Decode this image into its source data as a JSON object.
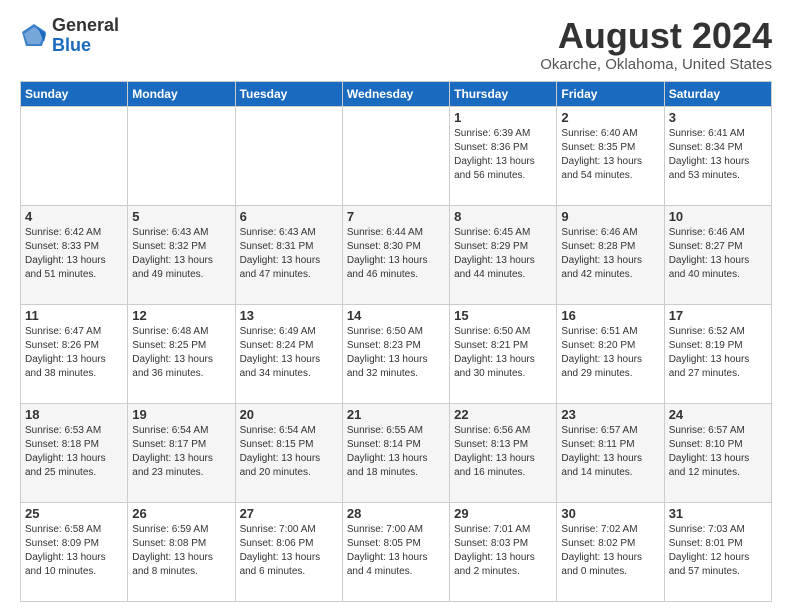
{
  "logo": {
    "general": "General",
    "blue": "Blue"
  },
  "header": {
    "title": "August 2024",
    "subtitle": "Okarche, Oklahoma, United States"
  },
  "weekdays": [
    "Sunday",
    "Monday",
    "Tuesday",
    "Wednesday",
    "Thursday",
    "Friday",
    "Saturday"
  ],
  "weeks": [
    [
      {
        "day": "",
        "info": ""
      },
      {
        "day": "",
        "info": ""
      },
      {
        "day": "",
        "info": ""
      },
      {
        "day": "",
        "info": ""
      },
      {
        "day": "1",
        "info": "Sunrise: 6:39 AM\nSunset: 8:36 PM\nDaylight: 13 hours\nand 56 minutes."
      },
      {
        "day": "2",
        "info": "Sunrise: 6:40 AM\nSunset: 8:35 PM\nDaylight: 13 hours\nand 54 minutes."
      },
      {
        "day": "3",
        "info": "Sunrise: 6:41 AM\nSunset: 8:34 PM\nDaylight: 13 hours\nand 53 minutes."
      }
    ],
    [
      {
        "day": "4",
        "info": "Sunrise: 6:42 AM\nSunset: 8:33 PM\nDaylight: 13 hours\nand 51 minutes."
      },
      {
        "day": "5",
        "info": "Sunrise: 6:43 AM\nSunset: 8:32 PM\nDaylight: 13 hours\nand 49 minutes."
      },
      {
        "day": "6",
        "info": "Sunrise: 6:43 AM\nSunset: 8:31 PM\nDaylight: 13 hours\nand 47 minutes."
      },
      {
        "day": "7",
        "info": "Sunrise: 6:44 AM\nSunset: 8:30 PM\nDaylight: 13 hours\nand 46 minutes."
      },
      {
        "day": "8",
        "info": "Sunrise: 6:45 AM\nSunset: 8:29 PM\nDaylight: 13 hours\nand 44 minutes."
      },
      {
        "day": "9",
        "info": "Sunrise: 6:46 AM\nSunset: 8:28 PM\nDaylight: 13 hours\nand 42 minutes."
      },
      {
        "day": "10",
        "info": "Sunrise: 6:46 AM\nSunset: 8:27 PM\nDaylight: 13 hours\nand 40 minutes."
      }
    ],
    [
      {
        "day": "11",
        "info": "Sunrise: 6:47 AM\nSunset: 8:26 PM\nDaylight: 13 hours\nand 38 minutes."
      },
      {
        "day": "12",
        "info": "Sunrise: 6:48 AM\nSunset: 8:25 PM\nDaylight: 13 hours\nand 36 minutes."
      },
      {
        "day": "13",
        "info": "Sunrise: 6:49 AM\nSunset: 8:24 PM\nDaylight: 13 hours\nand 34 minutes."
      },
      {
        "day": "14",
        "info": "Sunrise: 6:50 AM\nSunset: 8:23 PM\nDaylight: 13 hours\nand 32 minutes."
      },
      {
        "day": "15",
        "info": "Sunrise: 6:50 AM\nSunset: 8:21 PM\nDaylight: 13 hours\nand 30 minutes."
      },
      {
        "day": "16",
        "info": "Sunrise: 6:51 AM\nSunset: 8:20 PM\nDaylight: 13 hours\nand 29 minutes."
      },
      {
        "day": "17",
        "info": "Sunrise: 6:52 AM\nSunset: 8:19 PM\nDaylight: 13 hours\nand 27 minutes."
      }
    ],
    [
      {
        "day": "18",
        "info": "Sunrise: 6:53 AM\nSunset: 8:18 PM\nDaylight: 13 hours\nand 25 minutes."
      },
      {
        "day": "19",
        "info": "Sunrise: 6:54 AM\nSunset: 8:17 PM\nDaylight: 13 hours\nand 23 minutes."
      },
      {
        "day": "20",
        "info": "Sunrise: 6:54 AM\nSunset: 8:15 PM\nDaylight: 13 hours\nand 20 minutes."
      },
      {
        "day": "21",
        "info": "Sunrise: 6:55 AM\nSunset: 8:14 PM\nDaylight: 13 hours\nand 18 minutes."
      },
      {
        "day": "22",
        "info": "Sunrise: 6:56 AM\nSunset: 8:13 PM\nDaylight: 13 hours\nand 16 minutes."
      },
      {
        "day": "23",
        "info": "Sunrise: 6:57 AM\nSunset: 8:11 PM\nDaylight: 13 hours\nand 14 minutes."
      },
      {
        "day": "24",
        "info": "Sunrise: 6:57 AM\nSunset: 8:10 PM\nDaylight: 13 hours\nand 12 minutes."
      }
    ],
    [
      {
        "day": "25",
        "info": "Sunrise: 6:58 AM\nSunset: 8:09 PM\nDaylight: 13 hours\nand 10 minutes."
      },
      {
        "day": "26",
        "info": "Sunrise: 6:59 AM\nSunset: 8:08 PM\nDaylight: 13 hours\nand 8 minutes."
      },
      {
        "day": "27",
        "info": "Sunrise: 7:00 AM\nSunset: 8:06 PM\nDaylight: 13 hours\nand 6 minutes."
      },
      {
        "day": "28",
        "info": "Sunrise: 7:00 AM\nSunset: 8:05 PM\nDaylight: 13 hours\nand 4 minutes."
      },
      {
        "day": "29",
        "info": "Sunrise: 7:01 AM\nSunset: 8:03 PM\nDaylight: 13 hours\nand 2 minutes."
      },
      {
        "day": "30",
        "info": "Sunrise: 7:02 AM\nSunset: 8:02 PM\nDaylight: 13 hours\nand 0 minutes."
      },
      {
        "day": "31",
        "info": "Sunrise: 7:03 AM\nSunset: 8:01 PM\nDaylight: 12 hours\nand 57 minutes."
      }
    ]
  ]
}
